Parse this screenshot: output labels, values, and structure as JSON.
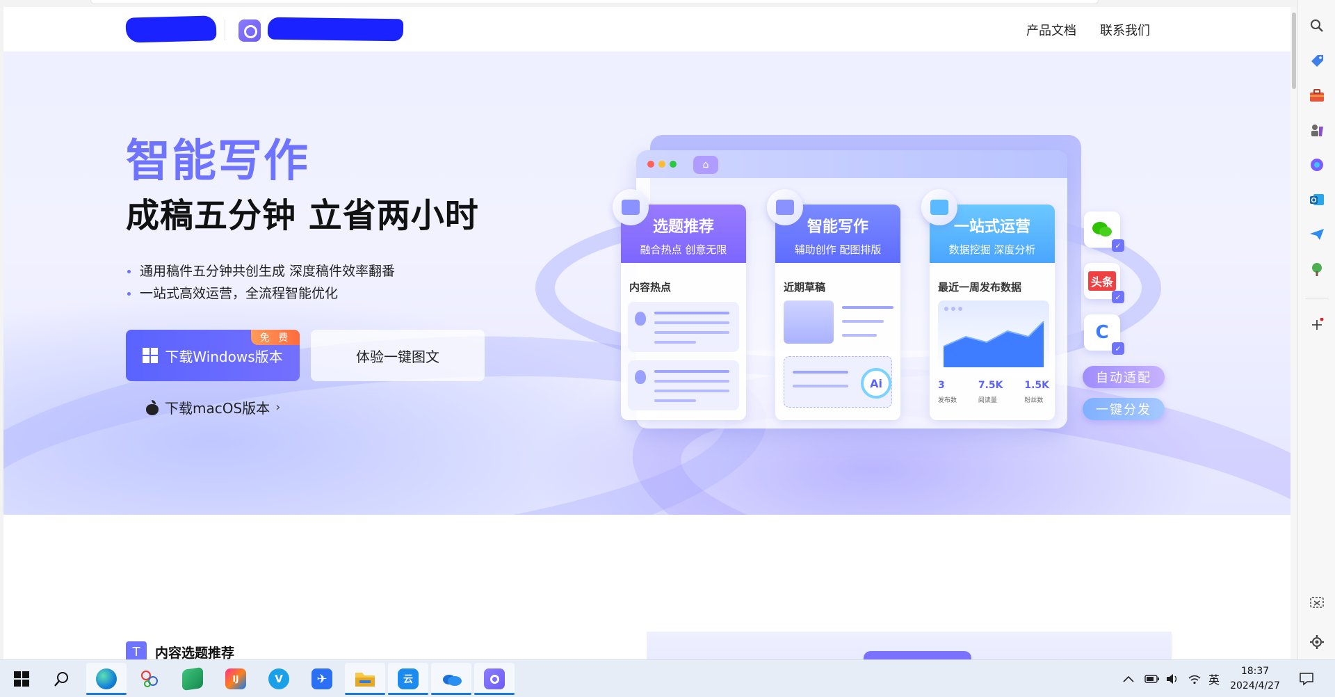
{
  "header": {
    "nav": [
      "产品文档",
      "联系我们"
    ]
  },
  "hero": {
    "title": "智能写作",
    "subtitle": "成稿五分钟 立省两小时",
    "bullets": [
      "通用稿件五分钟共创生成 深度稿件效率翻番",
      "一站式高效运营，全流程智能优化"
    ],
    "btn_windows": "下载Windows版本",
    "badge_free": "免 费",
    "btn_try": "体验一键图文",
    "mac_link": "下载macOS版本",
    "mac_chevron": "›"
  },
  "illustration": {
    "cards": [
      {
        "title": "选题推荐",
        "subtitle": "融合热点 创意无限",
        "body_title": "内容热点"
      },
      {
        "title": "智能写作",
        "subtitle": "辅助创作 配图排版",
        "body_title": "近期草稿"
      },
      {
        "title": "一站式运营",
        "subtitle": "数据挖掘 深度分析",
        "body_title": "最近一周发布数据"
      }
    ],
    "ai_label": "Ai",
    "stats": [
      {
        "value": "3",
        "label": "发布数"
      },
      {
        "value": "7.5K",
        "label": "阅读量"
      },
      {
        "value": "1.5K",
        "label": "粉丝数"
      }
    ],
    "side_icons": [
      {
        "icon": "wechat-icon",
        "label": ""
      },
      {
        "icon": "toutiao-icon",
        "label": "头条"
      },
      {
        "icon": "c-platform-icon",
        "label": "C"
      }
    ],
    "pills": [
      "自动适配",
      "一键分发"
    ],
    "colors": {
      "card1": "#8f6cff",
      "card2": "#6a7bff",
      "card3": "#56b6ff"
    }
  },
  "lower": {
    "icon_glyph": "T",
    "title": "内容选题推荐"
  },
  "right_sidebar": {
    "items": [
      "search-icon",
      "tag-icon",
      "toolbox-icon",
      "chess-icon",
      "copilot-icon",
      "outlook-icon",
      "send-icon",
      "tree-icon",
      "add-icon",
      "screenshot-icon",
      "settings-icon"
    ]
  },
  "taskbar": {
    "apps": [
      "start-icon",
      "search-icon",
      "edge-icon",
      "app-network-icon",
      "notebook-icon",
      "jetbrains-icon",
      "v-app-icon",
      "feishu-icon",
      "file-explorer-icon",
      "cloud-app-icon",
      "onedrive-icon",
      "writing-app-icon"
    ],
    "tray": {
      "ime": "英",
      "time": "18:37",
      "date": "2024/4/27"
    }
  }
}
